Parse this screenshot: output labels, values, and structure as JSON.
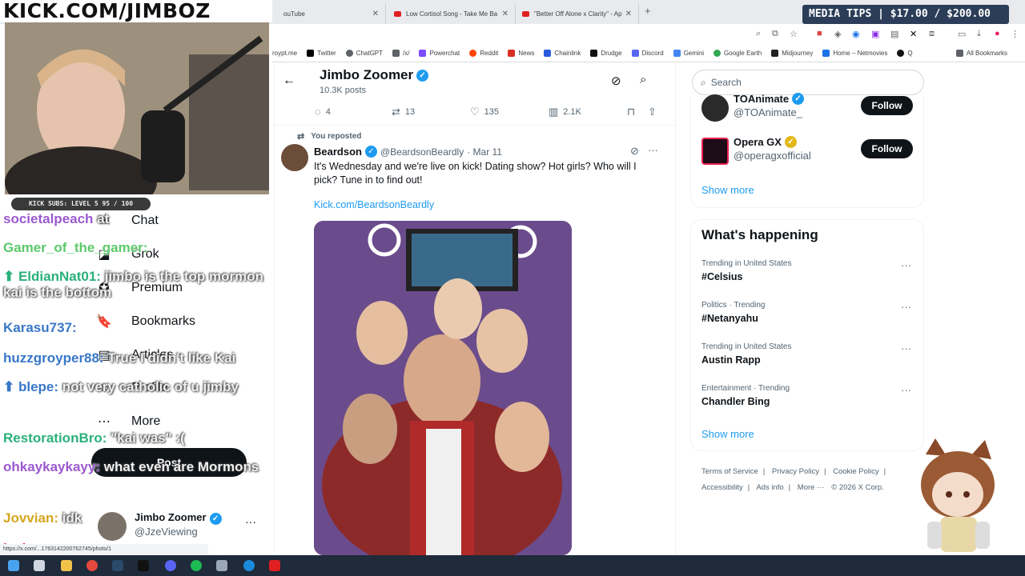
{
  "browser": {
    "tabs": [
      {
        "label": "ouTube"
      },
      {
        "label": "Low Cortisol Song - Take Me Ba"
      },
      {
        "label": "\"Better Off Alone x Clarity\" - Ap"
      }
    ],
    "new_tab_label": "+",
    "bookmarks": [
      "roypt.me",
      "Twitter",
      "ChatGPT",
      "/x/",
      "Powerchat",
      "Reddit",
      "News",
      "Chainlink",
      "Drudge",
      "Discord",
      "Gemini",
      "Google Earth",
      "Midjourney",
      "Home – Netmovies",
      "Q"
    ],
    "all_bookmarks": "All Bookmarks",
    "status_url": "https://x.com/...1763142200762745/photo/1"
  },
  "overlay": {
    "kick_title": "KICK.COM/JIMBOZ",
    "media_tips": "MEDIA TIPS | $17.00 / $200.00",
    "kick_subs": "KICK SUBS: LEVEL 5 95 / 100"
  },
  "chat": [
    {
      "user": "societalpeach",
      "msg": "at"
    },
    {
      "user": "Gamer_of_the_gamer",
      "msg": ""
    },
    {
      "user": "EldianNat01",
      "msg": "jimbo is the top mormon kai is the bottom"
    },
    {
      "user": "Karasu737",
      "msg": ""
    },
    {
      "user": "huzzgroyper88",
      "msg": "True I didn't like Kai"
    },
    {
      "user": "blepe",
      "msg": "not very catholic of u jimby"
    },
    {
      "user": "RestorationBro",
      "msg": "\"kai was\" :("
    },
    {
      "user": "ohkaykaykayy",
      "msg": "what even are Mormons"
    },
    {
      "user": "Jovvian",
      "msg": "idk"
    },
    {
      "user": "leakyqut",
      "msg": ""
    }
  ],
  "left_nav": {
    "items": [
      {
        "label": "Chat",
        "icon": "chat-icon"
      },
      {
        "label": "Grok",
        "icon": "grok-icon"
      },
      {
        "label": "Premium",
        "icon": "premium-icon"
      },
      {
        "label": "Bookmarks",
        "icon": "bookmark-icon"
      },
      {
        "label": "Articles",
        "icon": "articles-icon"
      },
      {
        "label": "Profile",
        "icon": "profile-icon"
      },
      {
        "label": "More",
        "icon": "more-icon"
      }
    ],
    "post_label": "Post",
    "profile_name": "Jimbo Zoomer",
    "profile_handle": "@JzeViewing",
    "profile_more": "···"
  },
  "main": {
    "title": "Jimbo Zoomer",
    "posts_count": "10.3K posts",
    "actions": {
      "replies": "4",
      "reposts": "13",
      "likes": "135",
      "views": "2.1K"
    },
    "repost_label": "You reposted",
    "tweet": {
      "name": "Beardson",
      "handle": "@BeardsonBeardly",
      "date": "· Mar 11",
      "text": "It's Wednesday and we're live on kick! Dating show? Hot girls? Who will I pick? Tune in to find out!",
      "link": "Kick.com/BeardsonBeardly"
    }
  },
  "sidebar": {
    "search_placeholder": "Search",
    "who_to_follow": [
      {
        "name": "TOAnimate",
        "handle": "@TOAnimate_",
        "follow": "Follow",
        "badge": "blue"
      },
      {
        "name": "Opera GX",
        "handle": "@operagxofficial",
        "follow": "Follow",
        "badge": "gold"
      }
    ],
    "show_more_1": "Show more",
    "happening_title": "What's happening",
    "trends": [
      {
        "context": "Trending in United States",
        "topic": "#Celsius"
      },
      {
        "context": "Politics · Trending",
        "topic": "#Netanyahu"
      },
      {
        "context": "Trending in United States",
        "topic": "Austin Rapp"
      },
      {
        "context": "Entertainment · Trending",
        "topic": "Chandler Bing"
      }
    ],
    "show_more_2": "Show more",
    "footer": [
      "Terms of Service",
      "|",
      "Privacy Policy",
      "|",
      "Cookie Policy",
      "|",
      "Accessibility",
      "|",
      "Ads info",
      "|",
      "More ···",
      "© 2026 X Corp."
    ]
  },
  "colors": {
    "accent": "#1d9bf0",
    "dark": "#0f1419",
    "muted": "#536471",
    "gold": "#e2b719"
  }
}
